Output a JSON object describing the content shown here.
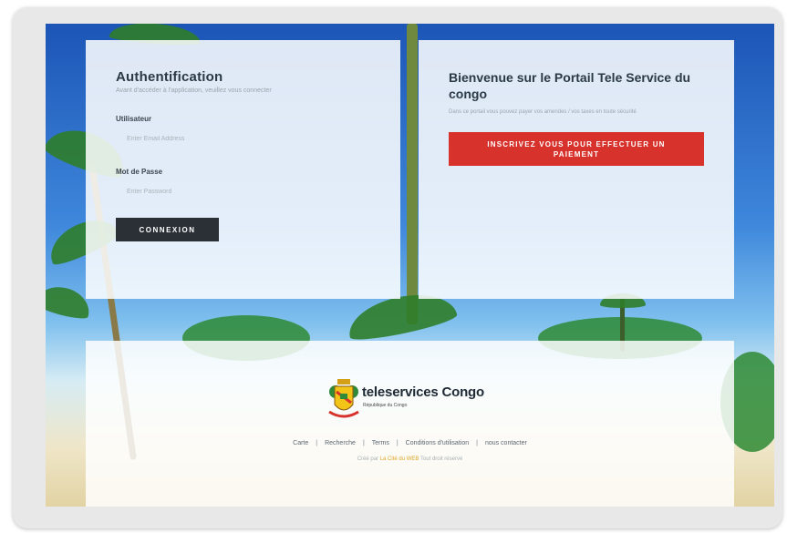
{
  "colors": {
    "primary_dark": "#2a3036",
    "accent_red": "#d8322d",
    "sky_blue": "#1c55b6",
    "credit_brand": "#e0a526"
  },
  "auth": {
    "title": "Authentification",
    "subtitle": "Avant d'accéder à l'application, veuillez vous connecter",
    "user_label": "Utilisateur",
    "user_placeholder": "Enter Email Address",
    "password_label": "Mot de Passe",
    "password_placeholder": "Enter Password",
    "login_button": "CONNEXION"
  },
  "welcome": {
    "title": "Bienvenue sur le Portail Tele Service du congo",
    "subtitle": "Dans ce portail vous pouvez payer vos amendes / vos taxes en toute sécurité",
    "register_button": "INSCRIVEZ VOUS POUR EFFECTUER UN PAIEMENT"
  },
  "footer": {
    "logo_name": "teleservices Congo",
    "logo_tagline": "République du Congo",
    "crest_icon": "congo-coat-of-arms-icon",
    "nav": [
      "Carte",
      "Recherche",
      "Terms",
      "Conditions d'utilisation",
      "nous contacter"
    ],
    "credit_prefix": "Créé par",
    "credit_brand": "La Cité du WEB",
    "credit_suffix": "Tout droit réservé"
  }
}
